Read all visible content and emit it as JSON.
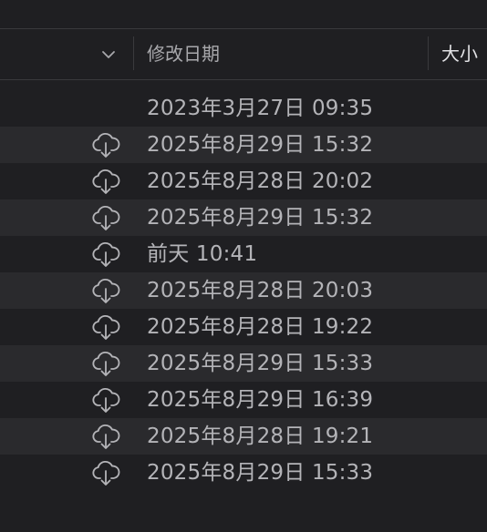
{
  "header": {
    "date_modified_label": "修改日期",
    "size_label": "大小"
  },
  "rows": [
    {
      "date": "2023年3月27日 09:35",
      "cloud": false
    },
    {
      "date": "2025年8月29日 15:32",
      "cloud": true
    },
    {
      "date": "2025年8月28日 20:02",
      "cloud": true
    },
    {
      "date": "2025年8月29日 15:32",
      "cloud": true
    },
    {
      "date": "前天 10:41",
      "cloud": true
    },
    {
      "date": "2025年8月28日 20:03",
      "cloud": true
    },
    {
      "date": "2025年8月28日 19:22",
      "cloud": true
    },
    {
      "date": "2025年8月29日 15:33",
      "cloud": true
    },
    {
      "date": "2025年8月29日 16:39",
      "cloud": true
    },
    {
      "date": "2025年8月28日 19:21",
      "cloud": true
    },
    {
      "date": "2025年8月29日 15:33",
      "cloud": true
    }
  ],
  "icons": {
    "chevron": "chevron-down-icon",
    "cloud": "cloud-download-icon"
  },
  "colors": {
    "background": "#1f1f22",
    "row_alt": "#2a2a2d",
    "text": "#b4b4b8"
  }
}
